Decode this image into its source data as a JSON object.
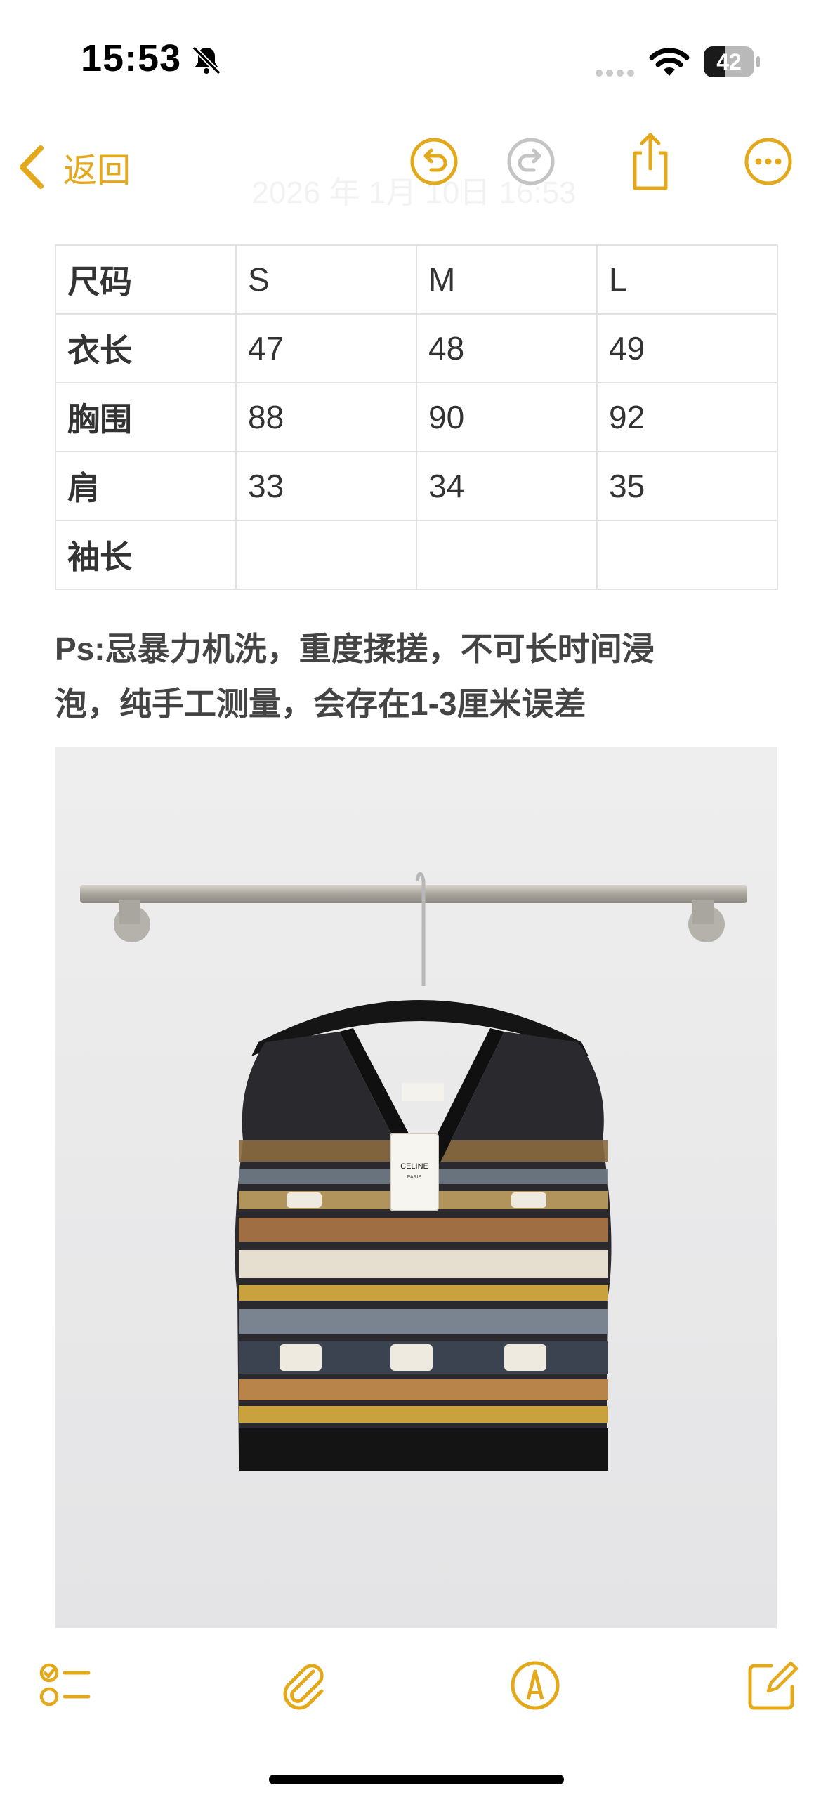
{
  "status_bar": {
    "time": "15:53",
    "battery_level": "42",
    "battery_fraction": 0.42
  },
  "nav": {
    "back_label": "返回",
    "date_faded": "2026 年 1月 10日 16:53",
    "accent_color": "#e3a91b"
  },
  "size_table": {
    "rows": [
      [
        "尺码",
        "S",
        "M",
        "L"
      ],
      [
        "衣长",
        "47",
        "48",
        "49"
      ],
      [
        "胸围",
        "88",
        "90",
        "92"
      ],
      [
        "肩",
        "33",
        "34",
        "35"
      ],
      [
        "袖长",
        "",
        "",
        ""
      ]
    ]
  },
  "note": {
    "line1": "Ps:忌暴力机洗，重度揉搓，不可长时间浸",
    "line2": "泡，纯手工测量，会存在1-3厘米误差"
  },
  "photo": {
    "tag_brand": "CELINE",
    "tag_sub": "PARIS"
  },
  "icons": {
    "back": "chevron-left-icon",
    "undo": "undo-icon",
    "redo": "redo-icon",
    "share": "share-icon",
    "more": "more-icon",
    "checklist": "checklist-icon",
    "attachment": "paperclip-icon",
    "markup": "markup-pen-icon",
    "compose": "compose-icon"
  }
}
